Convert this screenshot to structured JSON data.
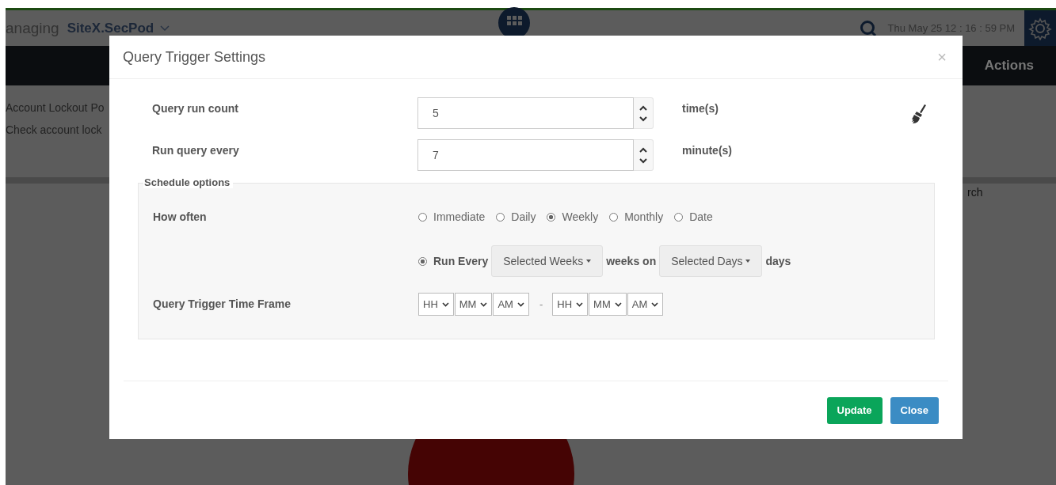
{
  "header": {
    "context_label": "anaging",
    "site": "SiteX.SecPod",
    "datetime": "Thu May 25  12 : 16 : 59 PM"
  },
  "nav": {
    "actions": "Actions"
  },
  "background_list": [
    "Account Lockout Po",
    "Check account lock"
  ],
  "search": {
    "placeholder": "rch"
  },
  "modal": {
    "title": "Query Trigger Settings",
    "close": "×",
    "fields": [
      {
        "label": "Query run count",
        "value": "5",
        "unit": "time(s)"
      },
      {
        "label": "Run query every",
        "value": "7",
        "unit": "minute(s)"
      }
    ],
    "schedule": {
      "legend": "Schedule options",
      "how_often_label": "How often",
      "frequencies": [
        {
          "label": "Immediate",
          "selected": false
        },
        {
          "label": "Daily",
          "selected": false
        },
        {
          "label": "Weekly",
          "selected": true
        },
        {
          "label": "Monthly",
          "selected": false
        },
        {
          "label": "Date",
          "selected": false
        }
      ],
      "run_every": {
        "selected": true,
        "label": "Run Every",
        "weeks_dropdown": "Selected Weeks",
        "weeks_on": "weeks on",
        "days_dropdown": "Selected Days",
        "days": "days"
      },
      "time_frame": {
        "label": "Query Trigger Time Frame",
        "start": [
          "HH",
          "MM",
          "AM"
        ],
        "separator": "-",
        "end": [
          "HH",
          "MM",
          "AM"
        ]
      }
    },
    "buttons": [
      {
        "label": "Update",
        "kind": "primary"
      },
      {
        "label": "Close",
        "kind": "secondary"
      }
    ]
  }
}
